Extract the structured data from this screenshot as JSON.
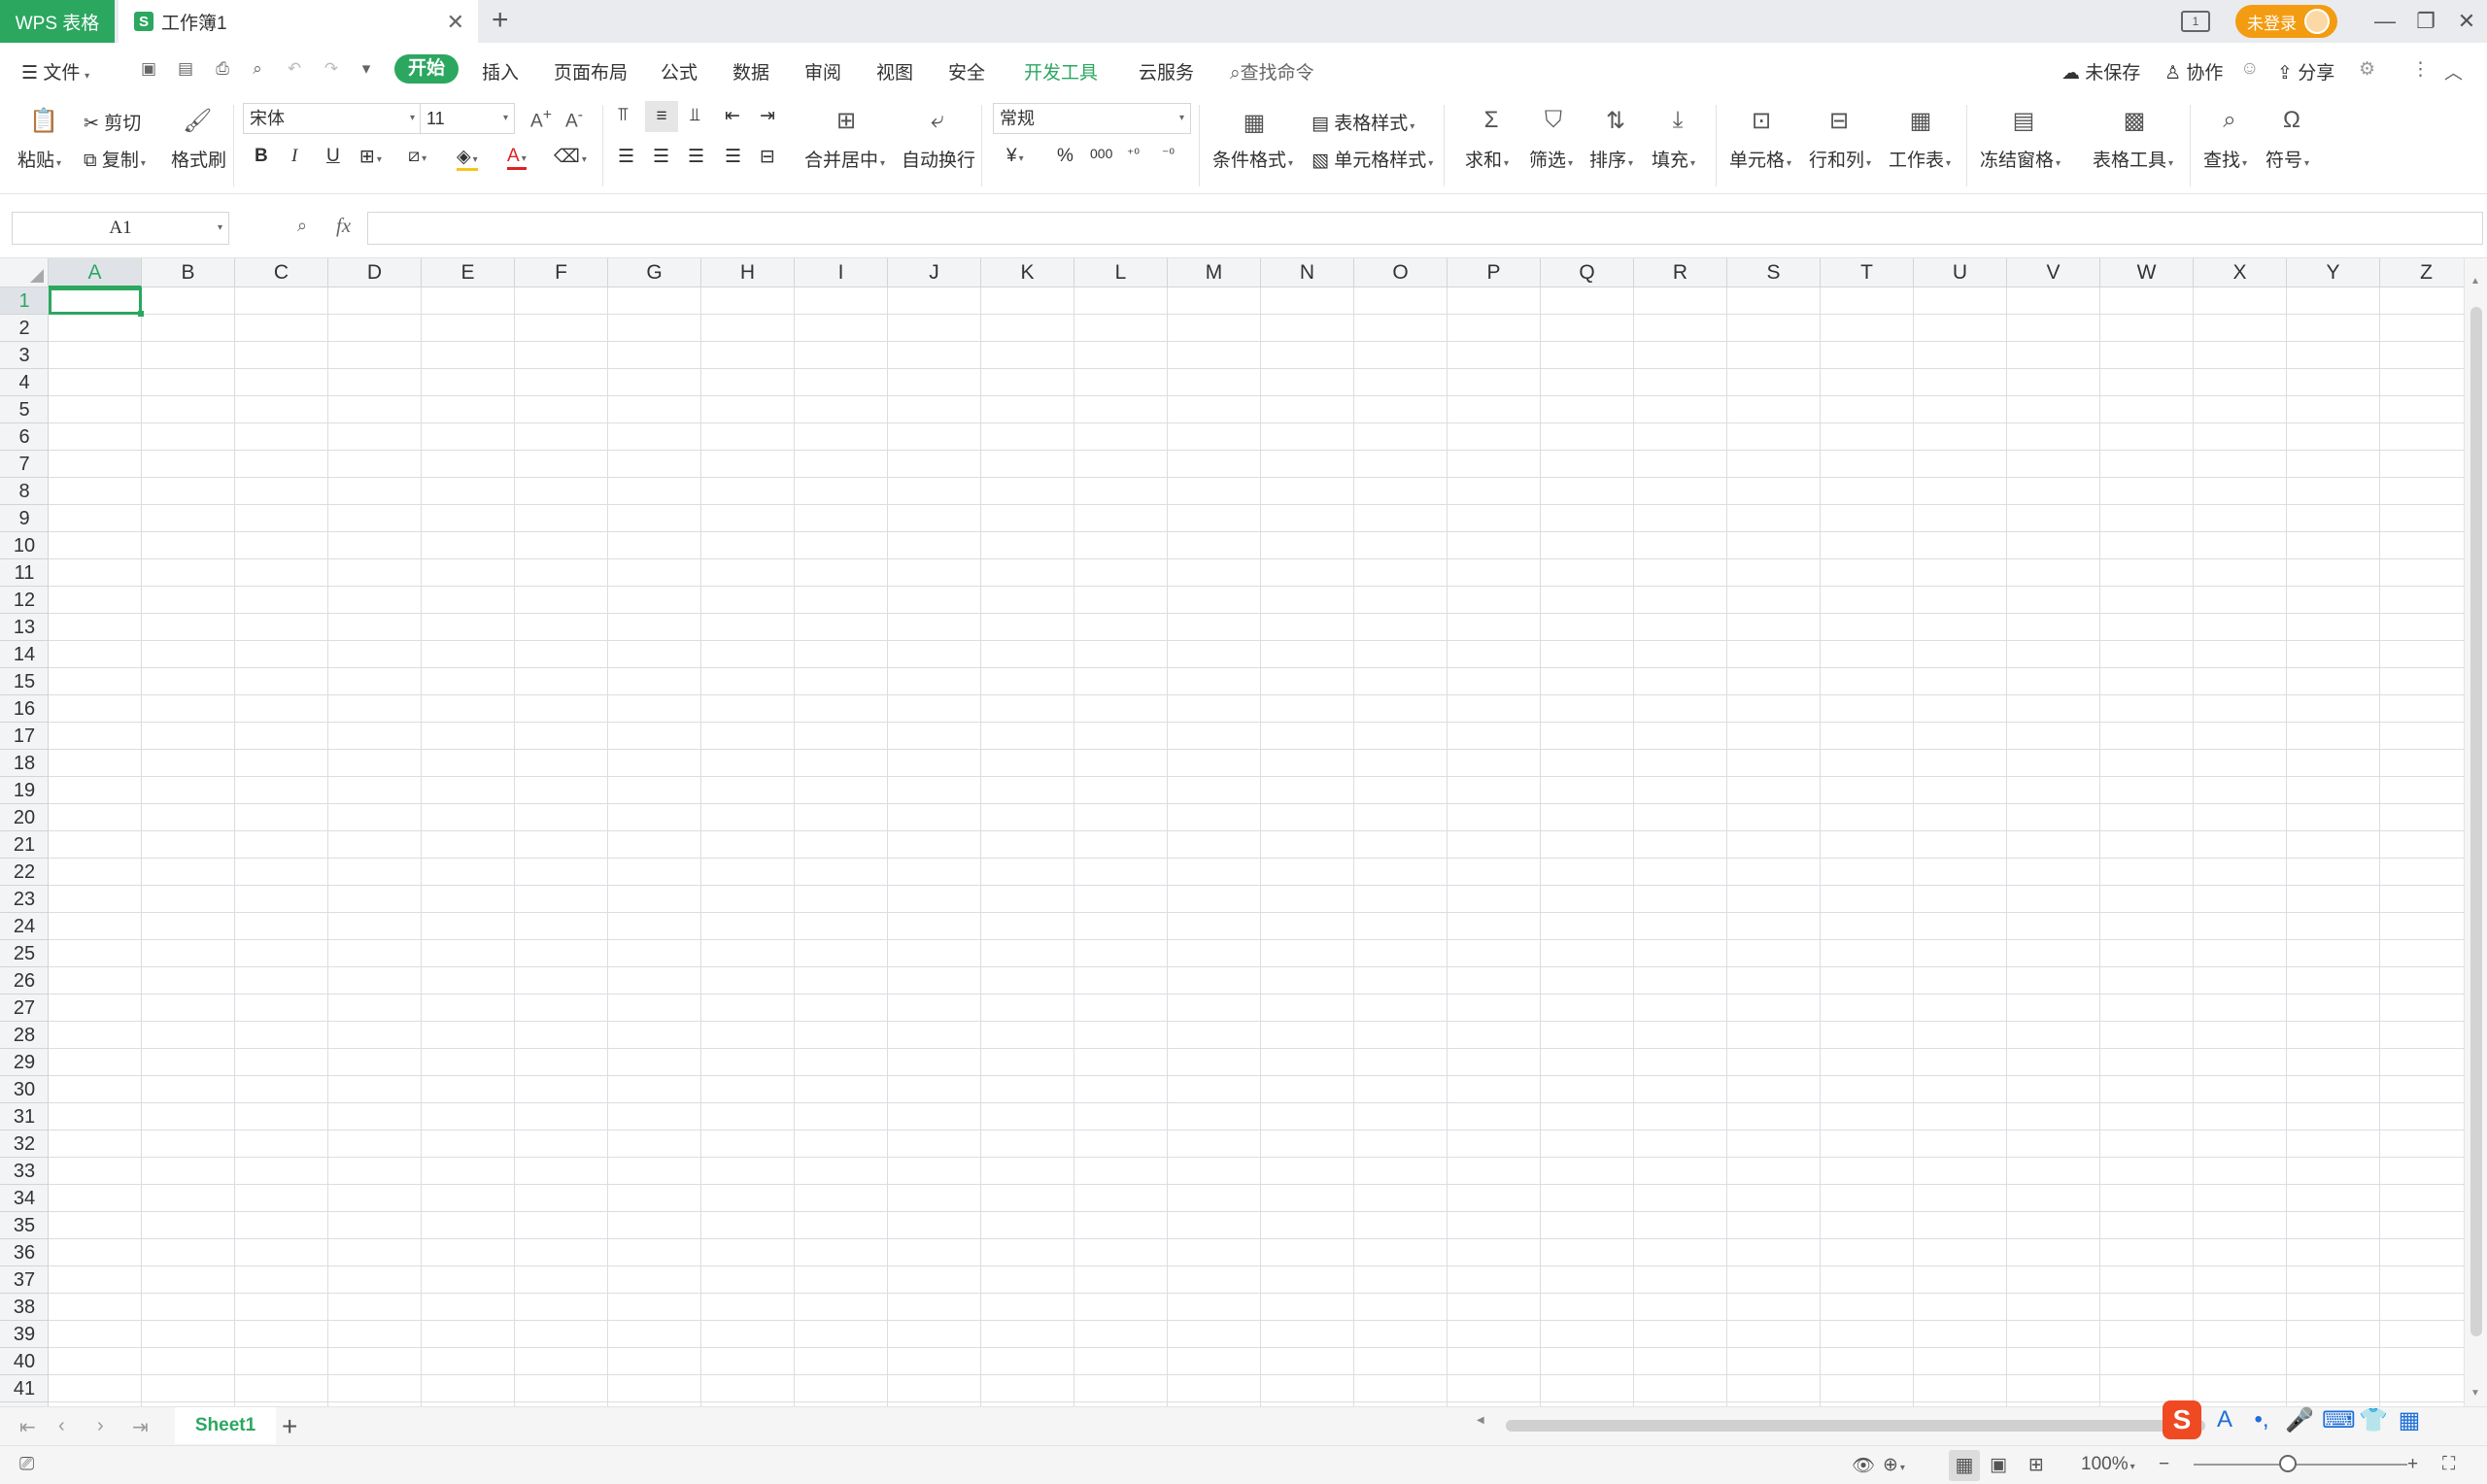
{
  "titlebar": {
    "app_tab": "WPS 表格",
    "doc_tab": "工作簿1",
    "doc_icon": "S",
    "login_label": "未登录"
  },
  "menubar": {
    "file_label": "文件",
    "tabs": [
      "开始",
      "插入",
      "页面布局",
      "公式",
      "数据",
      "审阅",
      "视图",
      "安全",
      "开发工具",
      "云服务"
    ],
    "search_label": "查找命令",
    "unsaved_label": "未保存",
    "collab_label": "协作",
    "share_label": "分享"
  },
  "ribbon": {
    "paste": "粘贴",
    "cut": "剪切",
    "copy": "复制",
    "format_painter": "格式刷",
    "font_name": "宋体",
    "font_size": "11",
    "merge_center": "合并居中",
    "wrap_text": "自动换行",
    "number_format": "常规",
    "conditional_format": "条件格式",
    "table_style": "表格样式",
    "cell_style": "单元格样式",
    "sum": "求和",
    "filter": "筛选",
    "sort": "排序",
    "fill": "填充",
    "cell": "单元格",
    "row_col": "行和列",
    "worksheet": "工作表",
    "freeze": "冻结窗格",
    "table_tools": "表格工具",
    "find": "查找",
    "symbol": "符号",
    "currency_symbol": "¥",
    "percent_symbol": "%",
    "thousands_symbol": "000"
  },
  "formula_bar": {
    "name_box": "A1",
    "fx": "fx",
    "value": ""
  },
  "grid": {
    "columns": [
      "A",
      "B",
      "C",
      "D",
      "E",
      "F",
      "G",
      "H",
      "I",
      "J",
      "K",
      "L",
      "M",
      "N",
      "O",
      "P",
      "Q",
      "R",
      "S",
      "T",
      "U",
      "V",
      "W",
      "X",
      "Y",
      "Z"
    ],
    "rows": [
      "1",
      "2",
      "3",
      "4",
      "5",
      "6",
      "7",
      "8",
      "9",
      "10",
      "11",
      "12",
      "13",
      "14",
      "15",
      "16",
      "17",
      "18",
      "19",
      "20",
      "21",
      "22",
      "23",
      "24",
      "25",
      "26",
      "27",
      "28",
      "29",
      "30",
      "31",
      "32",
      "33",
      "34",
      "35",
      "36",
      "37",
      "38",
      "39",
      "40",
      "41"
    ],
    "selected_cell": "A1"
  },
  "sheets": {
    "tabs": [
      "Sheet1"
    ],
    "active": "Sheet1"
  },
  "status": {
    "zoom": "100%"
  },
  "colors": {
    "accent": "#2ba760",
    "login": "#f39c12",
    "ime": "#f04a23"
  }
}
